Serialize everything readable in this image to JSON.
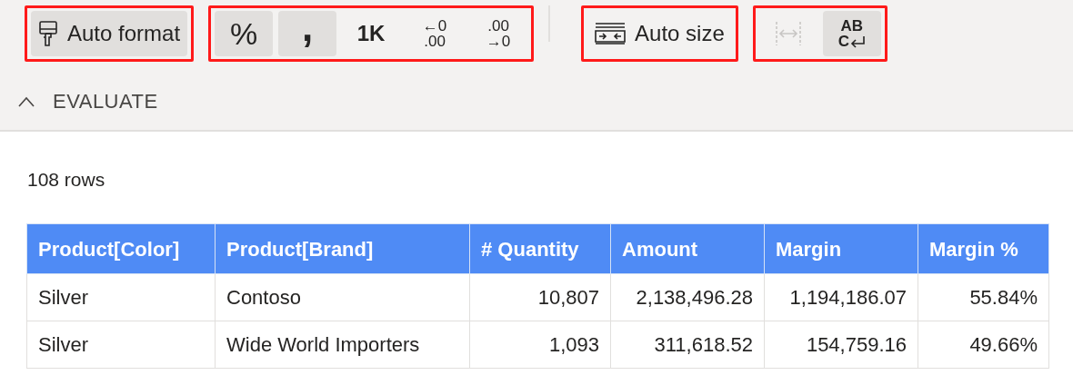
{
  "toolbar": {
    "groups": [
      {
        "highlighted": true,
        "buttons": [
          {
            "kind": "format",
            "label": "Auto format",
            "pressed": true,
            "disabled": false
          }
        ]
      },
      {
        "highlighted": true,
        "buttons": [
          {
            "kind": "text",
            "label": "%",
            "pressed": true,
            "disabled": false
          },
          {
            "kind": "comma",
            "label": ",",
            "pressed": true,
            "disabled": false
          },
          {
            "kind": "bold",
            "label": "1K",
            "pressed": false,
            "disabled": false
          },
          {
            "kind": "stack",
            "top": "←0",
            "bottom": ".00",
            "pressed": false,
            "disabled": false
          },
          {
            "kind": "stack",
            "top": ".00",
            "bottom": "→0",
            "pressed": false,
            "disabled": false
          }
        ]
      },
      {
        "highlighted": true,
        "separator": true,
        "buttons": [
          {
            "kind": "autosize",
            "label": "Auto size",
            "pressed": false,
            "disabled": false
          }
        ]
      },
      {
        "highlighted": true,
        "buttons": [
          {
            "kind": "fitwidth",
            "pressed": false,
            "disabled": true
          },
          {
            "kind": "wrap",
            "top": "AB",
            "bottom": "C",
            "pressed": true,
            "disabled": false
          }
        ]
      }
    ]
  },
  "section": {
    "title": "EVALUATE",
    "expanded": true
  },
  "row_count": "108 rows",
  "table": {
    "columns": [
      {
        "label": "Product[Color]",
        "kind": "text"
      },
      {
        "label": "Product[Brand]",
        "kind": "text"
      },
      {
        "label": "# Quantity",
        "kind": "number"
      },
      {
        "label": "Amount",
        "kind": "number"
      },
      {
        "label": "Margin",
        "kind": "number"
      },
      {
        "label": "Margin %",
        "kind": "number"
      }
    ],
    "rows": [
      [
        "Silver",
        "Contoso",
        "10,807",
        "2,138,496.28",
        "1,194,186.07",
        "55.84%"
      ],
      [
        "Silver",
        "Wide World Importers",
        "1,093",
        "311,618.52",
        "154,759.16",
        "49.66%"
      ]
    ]
  }
}
